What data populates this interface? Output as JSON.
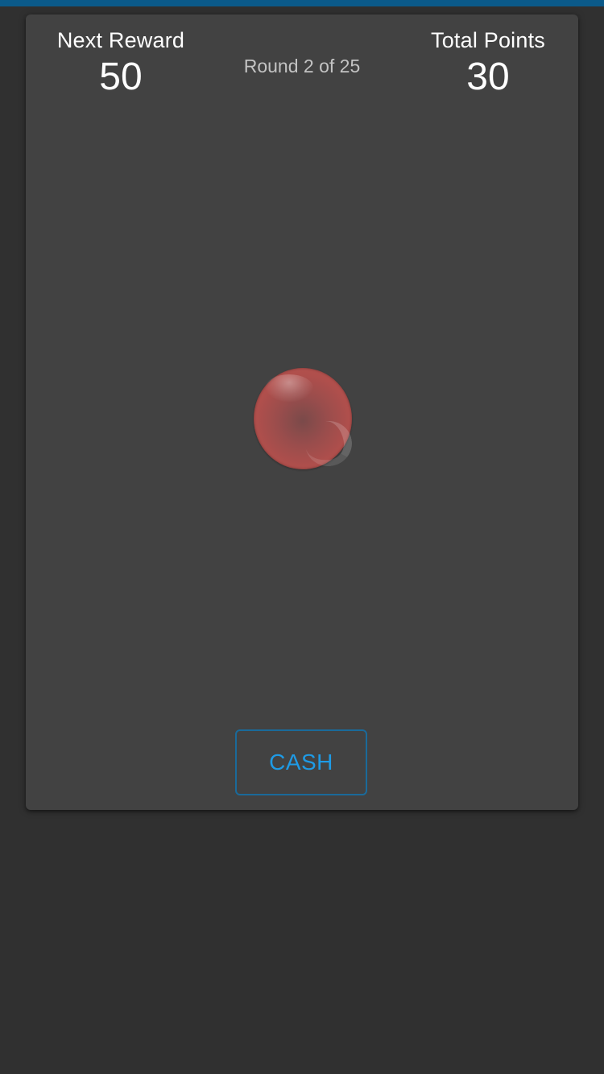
{
  "header": {
    "next_reward_label": "Next Reward",
    "next_reward_value": "50",
    "round_text": "Round 2 of 25",
    "total_points_label": "Total Points",
    "total_points_value": "30"
  },
  "balloon": {
    "icon": "balloon",
    "color": "#b04f4c"
  },
  "actions": {
    "cash_label": "CASH"
  },
  "colors": {
    "top_bar": "#0b5a8a",
    "background": "#303030",
    "card": "#424242",
    "accent": "#1e9be6"
  }
}
